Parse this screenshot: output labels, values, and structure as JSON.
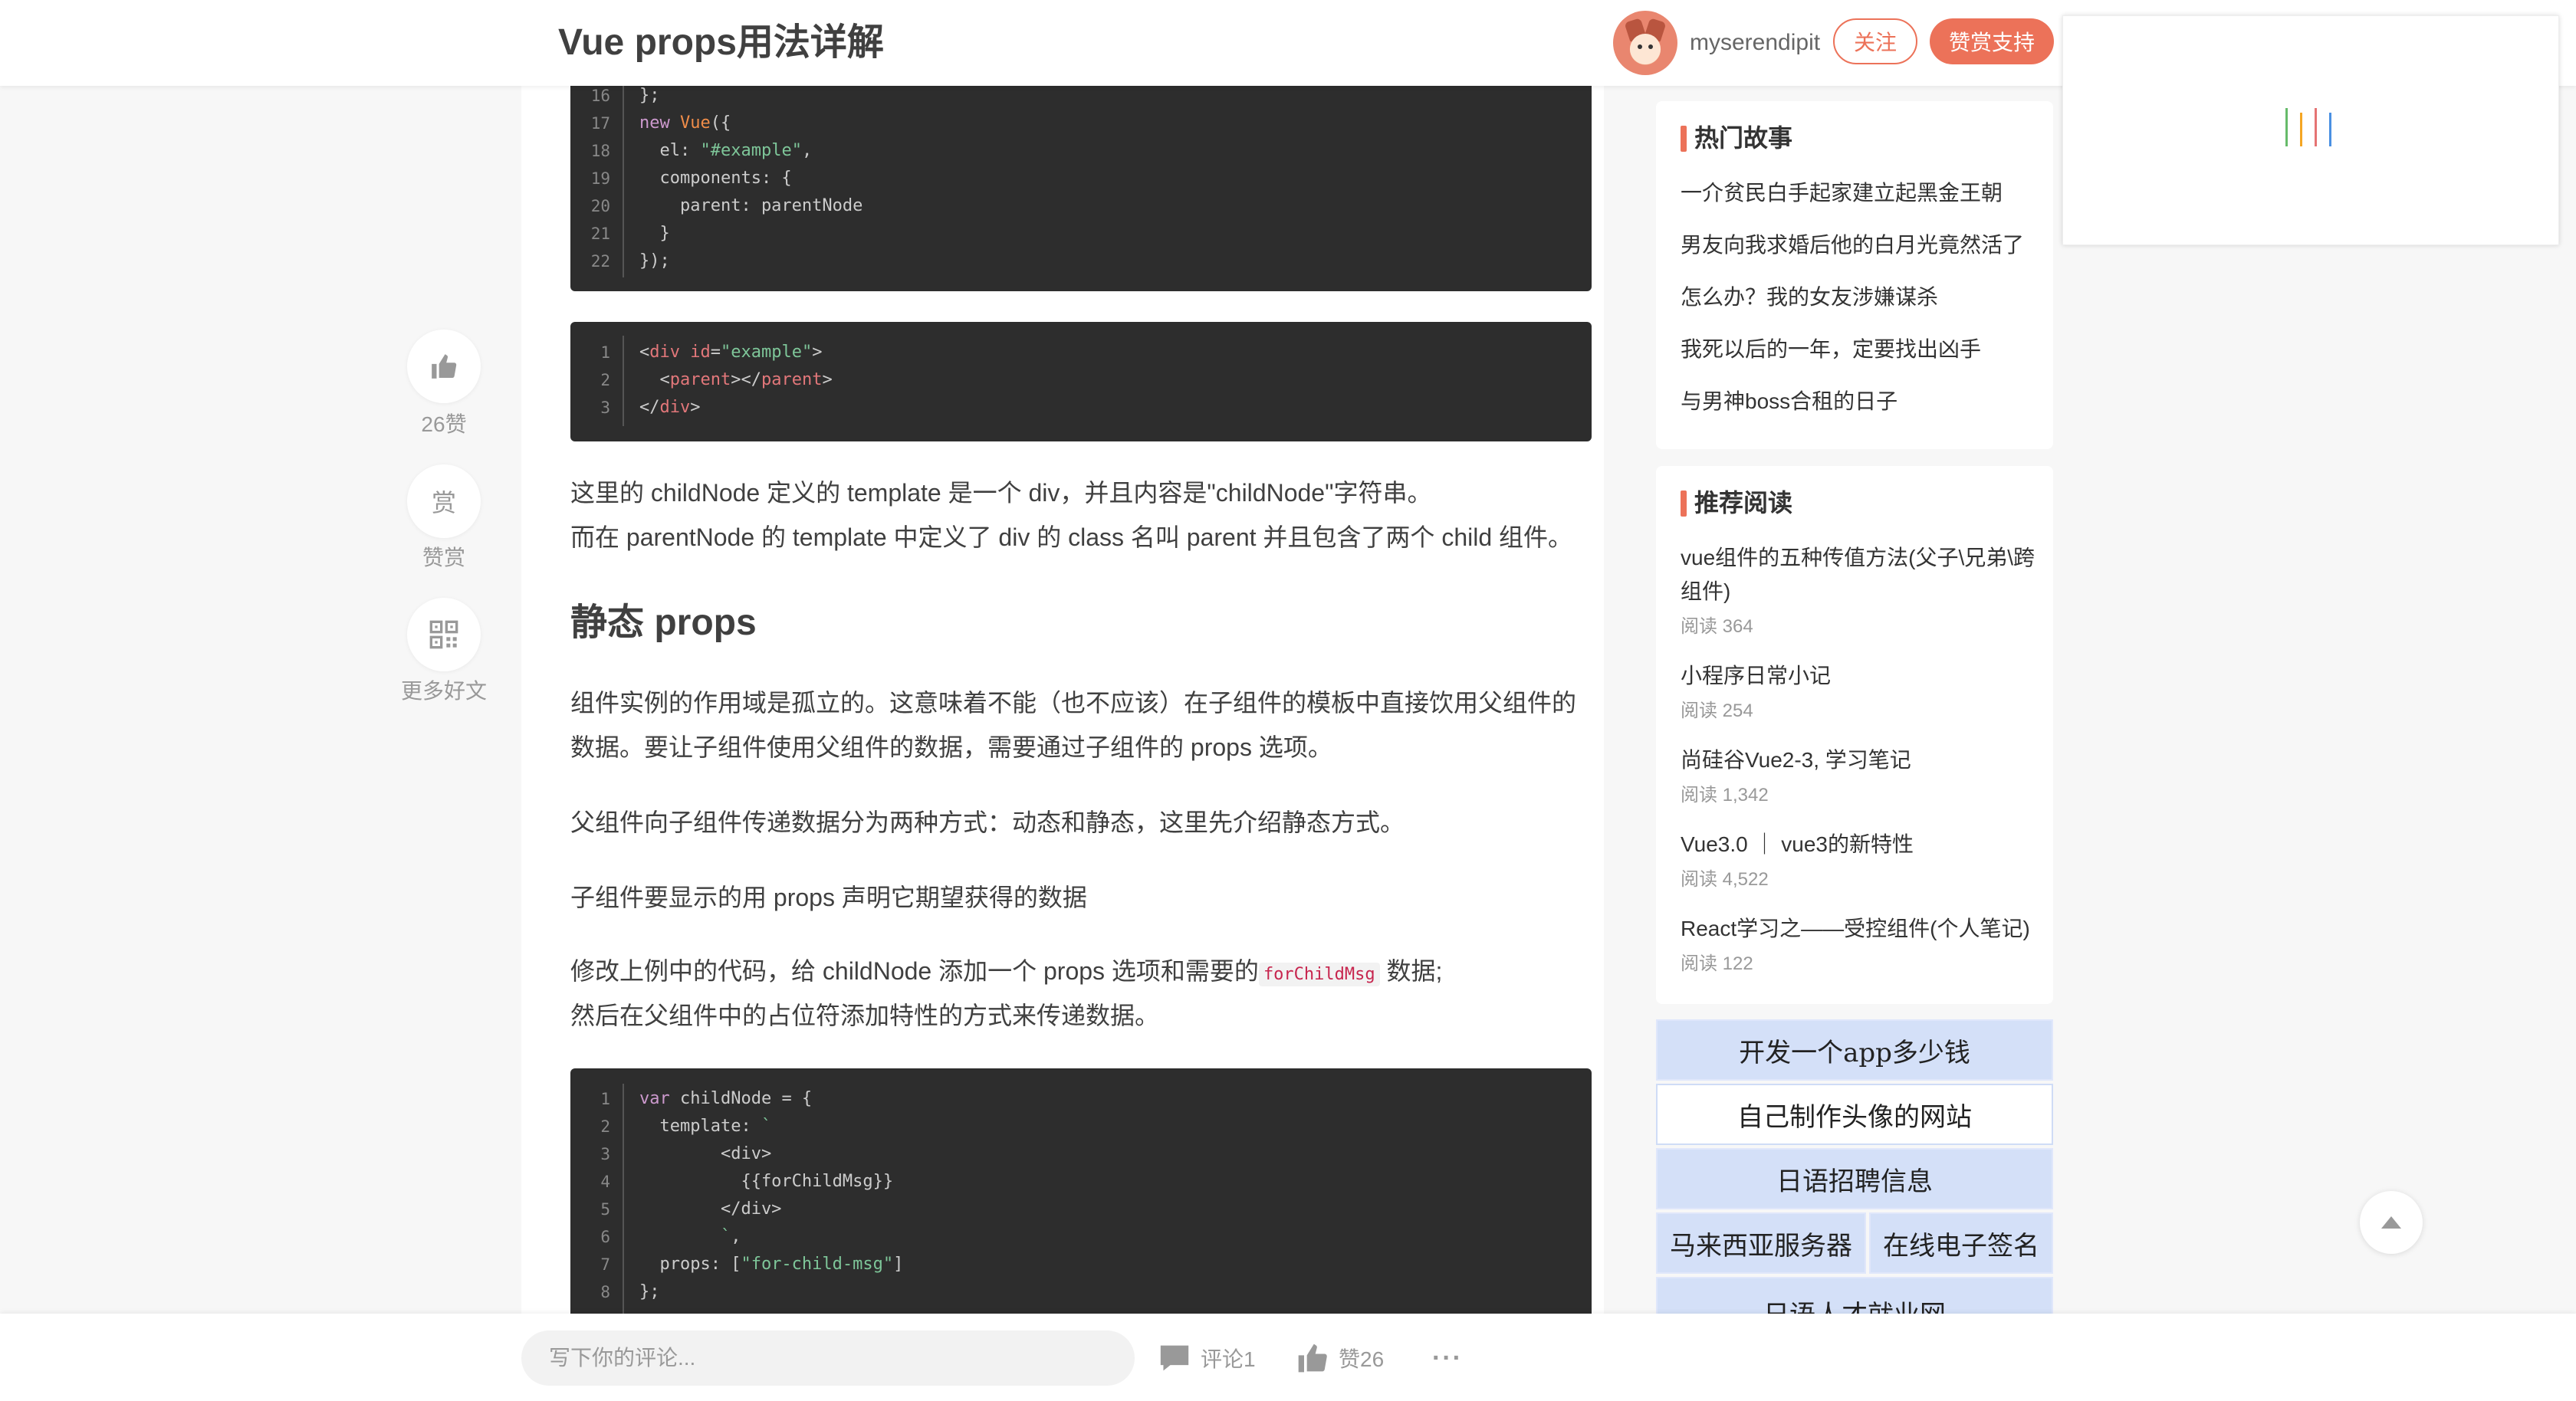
{
  "header": {
    "title": "Vue props用法详解",
    "author": "myserendipit",
    "follow_label": "关注",
    "reward_label": "赞赏支持"
  },
  "side_actions": {
    "like_label": "26赞",
    "reward_icon_text": "赏",
    "reward_label": "赞赏",
    "more_label": "更多好文"
  },
  "code_block_1": [
    {
      "n": "16",
      "t": "};"
    },
    {
      "n": "17",
      "t": "new Vue({"
    },
    {
      "n": "18",
      "t": "  el: \"#example\","
    },
    {
      "n": "19",
      "t": "  components: {"
    },
    {
      "n": "20",
      "t": "    parent: parentNode"
    },
    {
      "n": "21",
      "t": "  }"
    },
    {
      "n": "22",
      "t": "});"
    }
  ],
  "code_block_2": [
    {
      "n": "1",
      "t": "<div id=\"example\">"
    },
    {
      "n": "2",
      "t": "  <parent></parent>"
    },
    {
      "n": "3",
      "t": "</div>"
    }
  ],
  "code_block_3": [
    {
      "n": "1",
      "t": "var childNode = {"
    },
    {
      "n": "2",
      "t": "  template: `"
    },
    {
      "n": "3",
      "t": "        <div>"
    },
    {
      "n": "4",
      "t": "          {{forChildMsg}}"
    },
    {
      "n": "5",
      "t": "        </div>"
    },
    {
      "n": "6",
      "t": "        `,"
    },
    {
      "n": "7",
      "t": "  props: [\"for-child-msg\"]"
    },
    {
      "n": "8",
      "t": "};"
    }
  ],
  "article": {
    "p1_line1": "这里的 childNode 定义的 template 是一个 div，并且内容是\"childNode\"字符串。",
    "p1_line2": "而在 parentNode 的 template 中定义了 div 的 class 名叫 parent 并且包含了两个 child 组件。",
    "heading": "静态 props",
    "p2_line1": "组件实例的作用域是孤立的。这意味着不能（也不应该）在子组件的模板中直接饮用父组件的",
    "p2_line2": "数据。要让子组件使用父组件的数据，需要通过子组件的 props 选项。",
    "p3": "父组件向子组件传递数据分为两种方式：动态和静态，这里先介绍静态方式。",
    "p4": "子组件要显示的用 props 声明它期望获得的数据",
    "p5_before": "修改上例中的代码，给 childNode 添加一个 props 选项和需要的",
    "p5_code": "forChildMsg",
    "p5_after": " 数据;",
    "p5_line2": "然后在父组件中的占位符添加特性的方式来传递数据。"
  },
  "hot_stories": {
    "title": "热门故事",
    "items": [
      "一介贫民白手起家建立起黑金王朝",
      "男友向我求婚后他的白月光竟然活了",
      "怎么办？我的女友涉嫌谋杀",
      "我死以后的一年，定要找出凶手",
      "与男神boss合租的日子"
    ]
  },
  "recommended": {
    "title": "推荐阅读",
    "items": [
      {
        "title": "vue组件的五种传值方法(父子\\兄弟\\跨组件)",
        "reads": "阅读 364"
      },
      {
        "title": "小程序日常小记",
        "reads": "阅读 254"
      },
      {
        "title": "尚硅谷Vue2-3, 学习笔记",
        "reads": "阅读 1,342"
      },
      {
        "title": "Vue3.0 ｜ vue3的新特性",
        "reads": "阅读 4,522"
      },
      {
        "title": "React学习之——受控组件(个人笔记)",
        "reads": "阅读 122"
      }
    ]
  },
  "ads": [
    "开发一个app多少钱",
    "自己制作头像的网站",
    "日语招聘信息",
    "马来西亚服务器",
    "在线电子签名",
    "日语人才就业网"
  ],
  "bottom_bar": {
    "comment_placeholder": "写下你的评论...",
    "comment_label": "评论1",
    "like_label": "赞26",
    "more_label": "···"
  },
  "colors": {
    "accent": "#ec7259",
    "code_bg": "#2d2d2d",
    "ad_bg": "#d4e0f8"
  }
}
